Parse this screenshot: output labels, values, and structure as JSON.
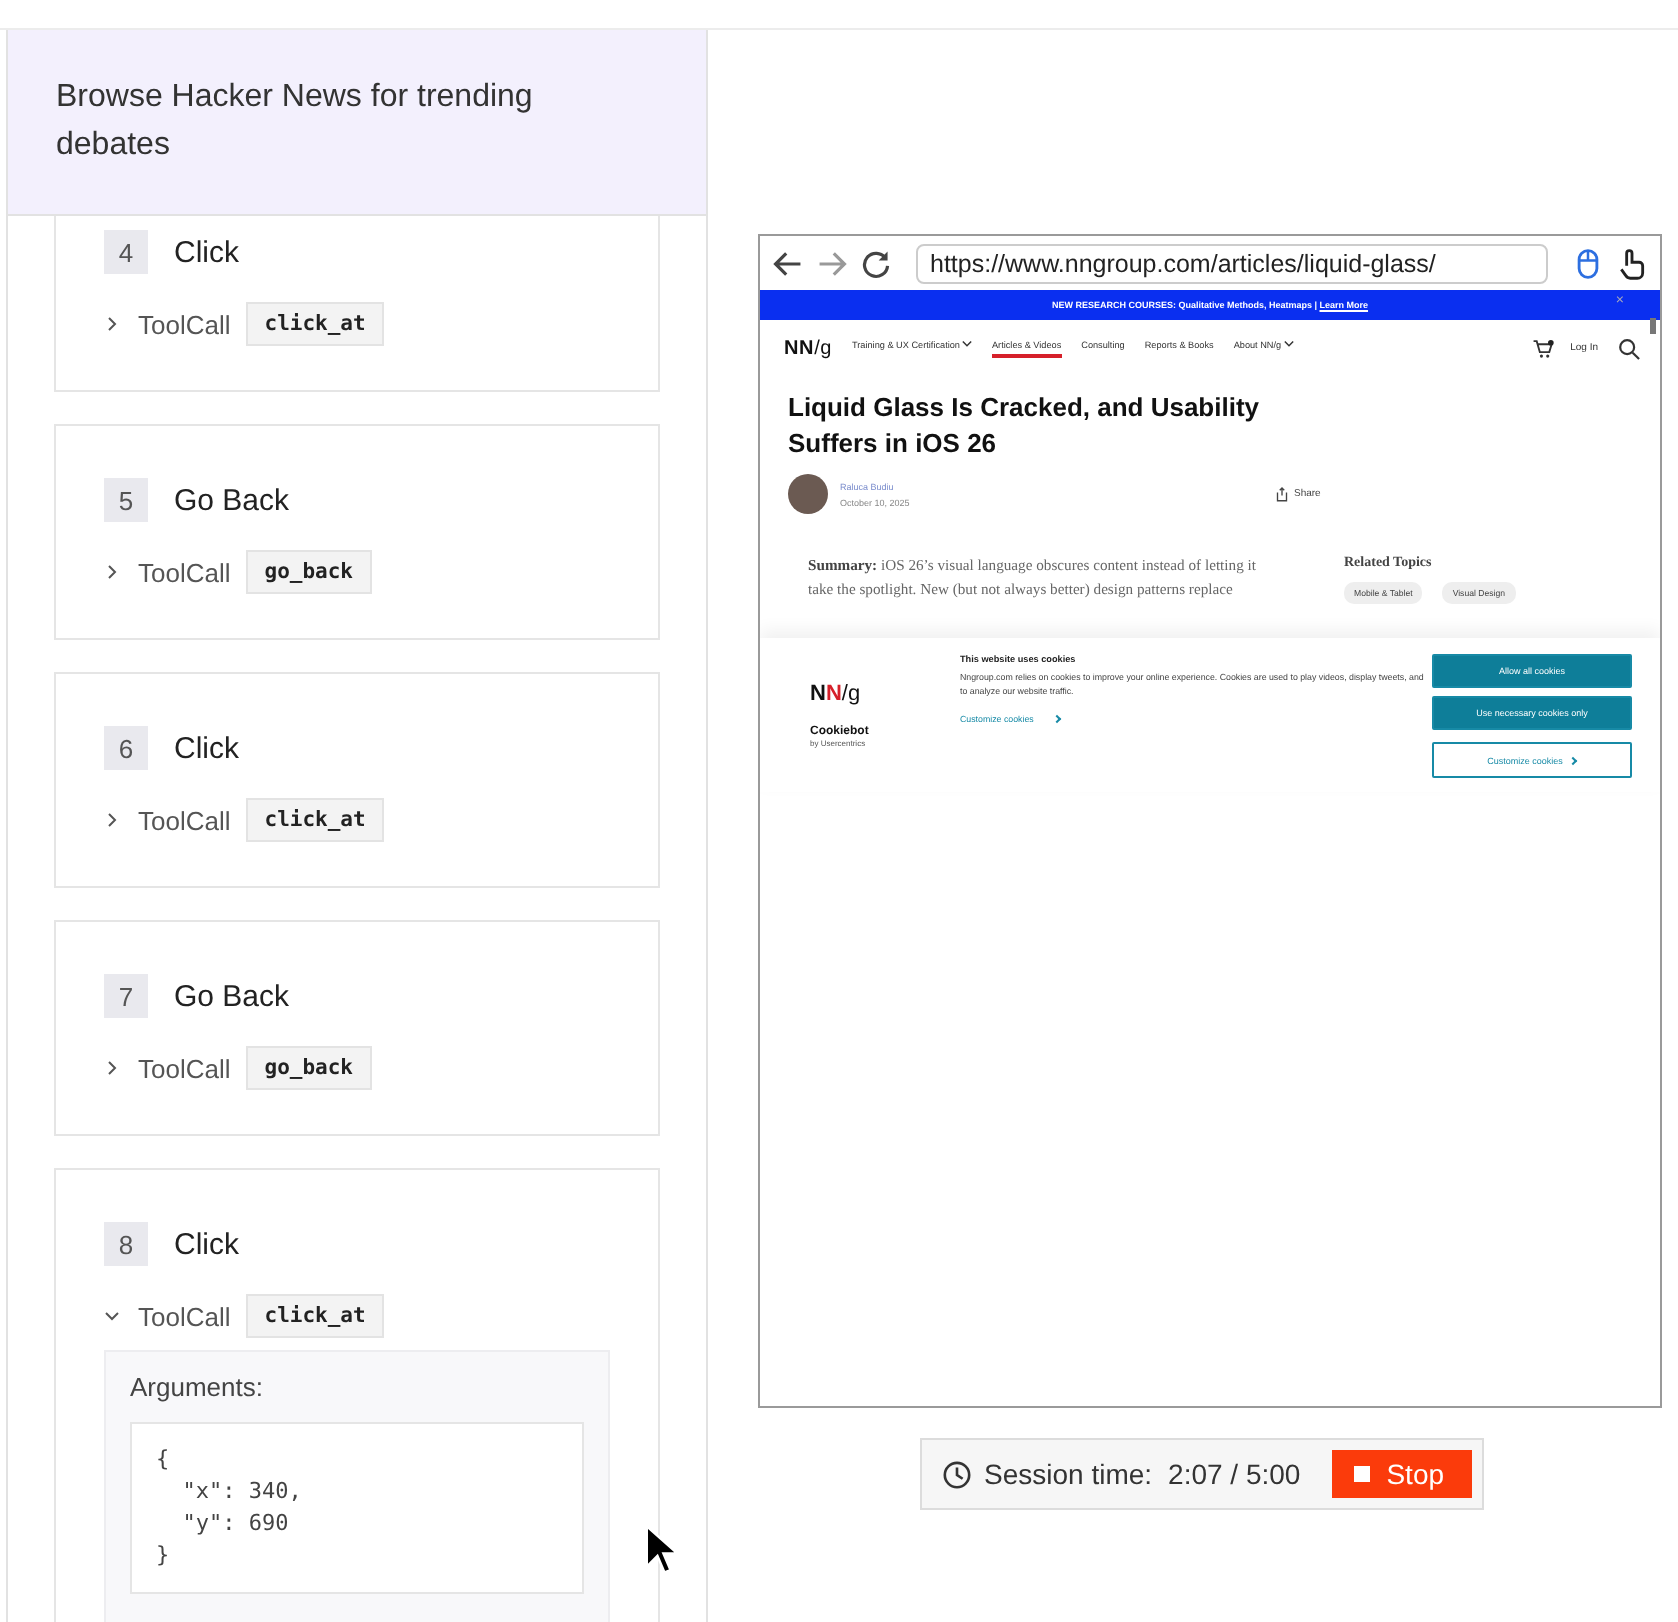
{
  "task": {
    "title": "Browse Hacker News for trending debates"
  },
  "steps": [
    {
      "number": "4",
      "title": "Click",
      "tool_label": "ToolCall",
      "function": "click_at",
      "expanded": false
    },
    {
      "number": "5",
      "title": "Go Back",
      "tool_label": "ToolCall",
      "function": "go_back",
      "expanded": false
    },
    {
      "number": "6",
      "title": "Click",
      "tool_label": "ToolCall",
      "function": "click_at",
      "expanded": false
    },
    {
      "number": "7",
      "title": "Go Back",
      "tool_label": "ToolCall",
      "function": "go_back",
      "expanded": false
    },
    {
      "number": "8",
      "title": "Click",
      "tool_label": "ToolCall",
      "function": "click_at",
      "expanded": true,
      "arguments_label": "Arguments:",
      "arguments": "{\n  \"x\": 340,\n  \"y\": 690\n}"
    }
  ],
  "browser": {
    "url": "https://www.nngroup.com/articles/liquid-glass/",
    "banner": {
      "text": "NEW RESEARCH COURSES: Qualitative Methods, Heatmaps | ",
      "link": "Learn More",
      "close": "×"
    },
    "logo": [
      {
        "text": "N",
        "color": "#111111"
      },
      {
        "text": "N",
        "color": "#111111"
      },
      {
        "text": "/g",
        "color": "#111111"
      }
    ],
    "nav": [
      {
        "label": "Training & UX Certification",
        "dropdown": true,
        "selected": false
      },
      {
        "label": "Articles & Videos",
        "dropdown": false,
        "selected": true
      },
      {
        "label": "Consulting",
        "dropdown": false,
        "selected": false
      },
      {
        "label": "Reports & Books",
        "dropdown": false,
        "selected": false
      },
      {
        "label": "About NN/g",
        "dropdown": true,
        "selected": false
      }
    ],
    "login": "Log In",
    "article": {
      "title": "Liquid Glass Is Cracked, and Usability Suffers in iOS 26",
      "author": "Raluca Budiu",
      "date": "October 10, 2025",
      "share": "Share",
      "summary": "**Summary:**  iOS 26’s visual language obscures content instead of letting it take the spotlight. New (but not always better) design patterns replace",
      "related_title": "Related Topics",
      "related": [
        "Mobile & Tablet",
        "Visual Design"
      ]
    },
    "cookies": {
      "logo": [
        {
          "text": "N",
          "color": "#111111"
        },
        {
          "text": "N",
          "color": "#d6202a"
        },
        {
          "text": "/g",
          "color": "#111111"
        }
      ],
      "brand": "Cookiebot",
      "brand_sub": "by Usercentrics",
      "title": "This website uses cookies",
      "text": "Nngroup.com relies on cookies to improve your online experience. Cookies are used to play videos, display tweets, and to analyze our website traffic.",
      "customize_link": "Customize cookies",
      "buttons": [
        {
          "label": "Allow all cookies",
          "kind": "primary"
        },
        {
          "label": "Use necessary cookies only",
          "kind": "primary"
        },
        {
          "label": "Customize cookies",
          "kind": "outline"
        }
      ]
    }
  },
  "session": {
    "label": "Session time:",
    "time": "2:07 / 5:00",
    "stop": "Stop"
  }
}
